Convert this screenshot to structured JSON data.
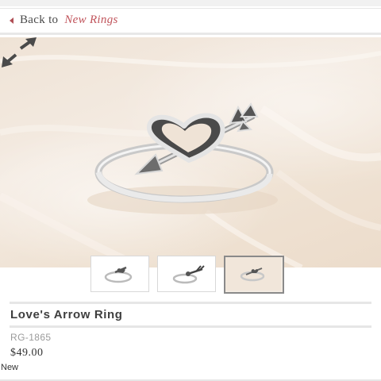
{
  "nav": {
    "back_label": "Back to",
    "category": "New Rings"
  },
  "gallery": {
    "expand_icon": "expand-arrows-icon",
    "thumbnails": [
      {
        "name": "thumb-ring-side"
      },
      {
        "name": "thumb-ring-angle"
      },
      {
        "name": "thumb-ring-on-fabric"
      }
    ],
    "active_thumbnail": 3
  },
  "product": {
    "title": "Love's Arrow Ring",
    "sku": "RG-1865",
    "price": "$49.00",
    "badge": "New"
  },
  "colors": {
    "accent": "#c0535a",
    "text": "#3e3e3e",
    "muted": "#9a9a9a",
    "silver": "#d9d9d9"
  }
}
